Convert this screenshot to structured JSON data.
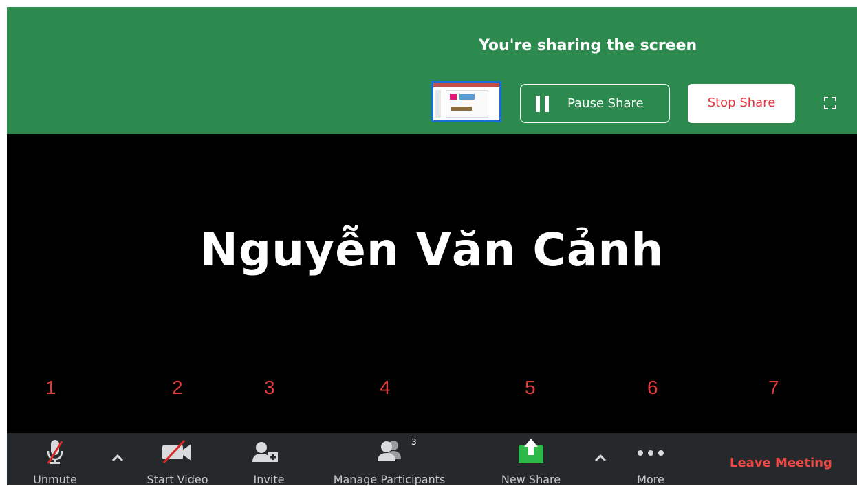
{
  "share_bar": {
    "title": "You're sharing the screen",
    "pause_label": "Pause Share",
    "stop_label": "Stop Share",
    "background_color": "#2d8a4e"
  },
  "stage": {
    "participant_name": "Nguyễn Văn Cảnh",
    "annotations": [
      "1",
      "2",
      "3",
      "4",
      "5",
      "6",
      "7"
    ],
    "annotation_color": "#e03a3a"
  },
  "toolbar": {
    "unmute_label": "Unmute",
    "start_video_label": "Start Video",
    "invite_label": "Invite",
    "manage_participants_label": "Manage Participants",
    "participant_count": "3",
    "new_share_label": "New Share",
    "more_label": "More",
    "leave_label": "Leave Meeting",
    "leave_color": "#f04848"
  },
  "icons": {
    "unmute": "muted-microphone-icon",
    "start_video": "video-off-icon",
    "invite": "add-person-icon",
    "participants": "participants-icon",
    "new_share": "share-screen-icon",
    "more": "more-dots-icon",
    "fullscreen": "fullscreen-icon",
    "pause": "pause-icon",
    "caret": "chevron-up-icon"
  }
}
